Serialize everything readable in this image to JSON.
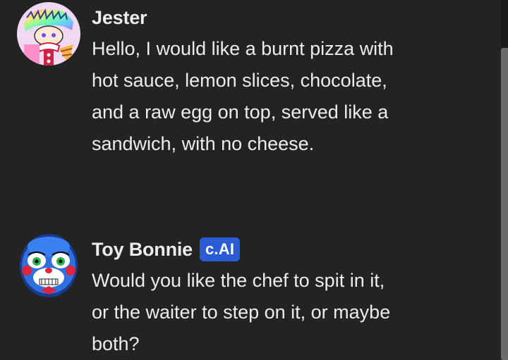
{
  "messages": [
    {
      "author": "Jester",
      "badge": "",
      "text": "Hello, I would like a burnt pizza with\nhot sauce, lemon slices, chocolate,\nand a raw egg on top, served like a\nsandwich, with no cheese."
    },
    {
      "author": "Toy Bonnie",
      "badge": "c.AI",
      "text": "Would you like the chef to spit in it,\nor the waiter to step on it, or maybe\nboth?"
    }
  ],
  "colors": {
    "background": "#232323",
    "text": "#ececec",
    "badge": "#2b5cd6",
    "scrollbar_thumb": "#6b6b6b"
  },
  "icons": {
    "message_1_avatar": "jester-avatar",
    "message_2_avatar": "toy-bonnie-avatar"
  }
}
